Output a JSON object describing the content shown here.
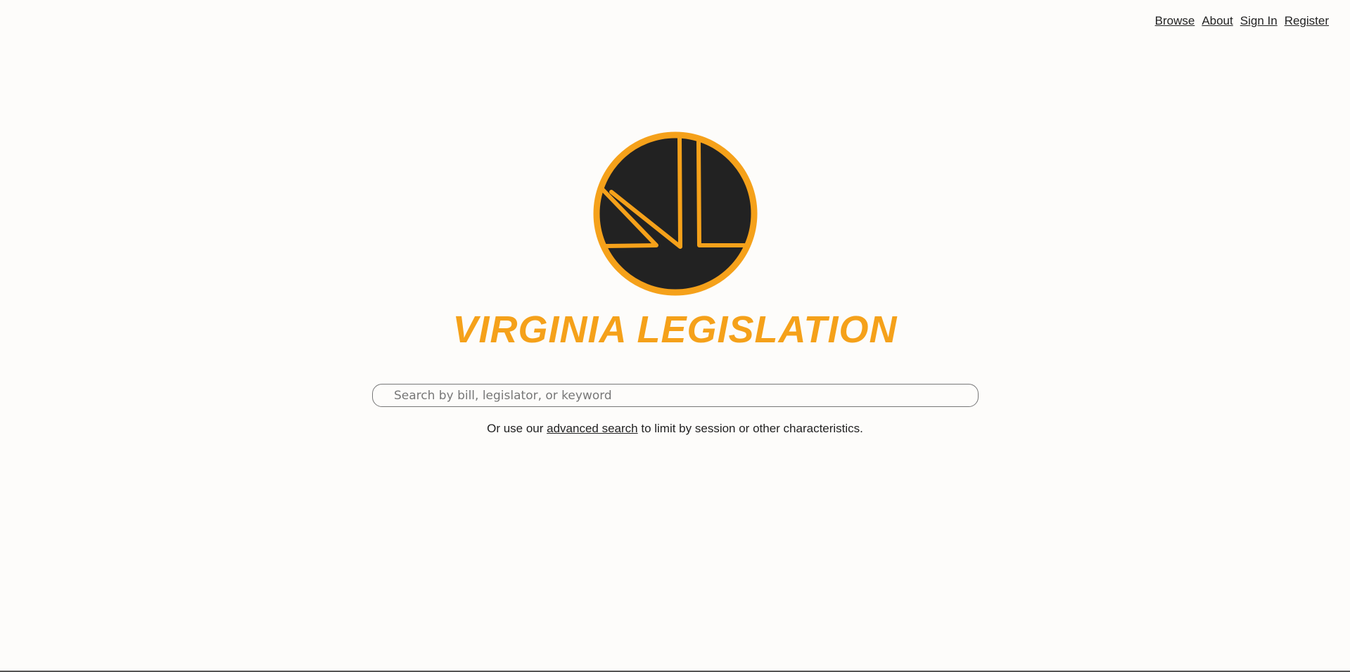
{
  "nav": {
    "links": [
      {
        "label": "Browse"
      },
      {
        "label": "About"
      },
      {
        "label": "Sign In"
      },
      {
        "label": "Register"
      }
    ]
  },
  "brand": {
    "title": "VIRGINIA LEGISLATION",
    "logo_icon": "vl-monogram-icon",
    "accent_color": "#f5a11a",
    "logo_fill_color": "#222222"
  },
  "search": {
    "placeholder": "Search by bill, legislator, or keyword",
    "value": ""
  },
  "helper": {
    "prefix": "Or use our ",
    "link": "advanced search",
    "suffix": " to limit by session or other characteristics."
  }
}
